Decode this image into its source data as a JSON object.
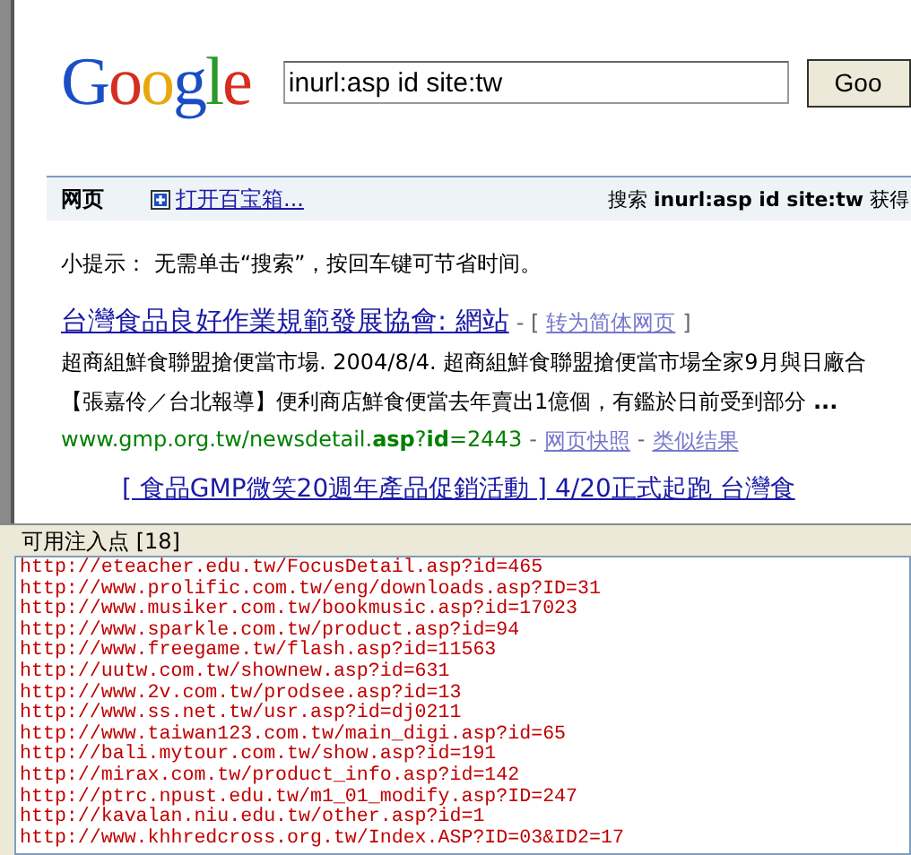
{
  "logo": "Google",
  "search": {
    "value": "inurl:asp id site:tw",
    "button": "Goo"
  },
  "bar": {
    "tab": "网页",
    "toolbox_link": "打开百宝箱...",
    "summary": "搜索 **inurl:asp id site:tw** 获得"
  },
  "tip": "小提示：  无需单击“搜索”，按回车键可节省时间。",
  "results": [
    {
      "title": "台灣食品良好作業規範發展協會: 網站",
      "sep_open": "- [",
      "translate": "转为简体网页",
      "sep_close": "]",
      "sep": "-",
      "snippet": [
        "超商組鮮食聯盟搶便當市場. 2004/8/4. 超商組鮮食聯盟搶便當市場全家9月與日廠合",
        "【張嘉伶／台北報導】便利商店鮮食便當去年賣出1億個，有鑑於日前受到部分 **...**"
      ],
      "url": "www.gmp.org.tw/newsdetail.**asp**?**id**=2443",
      "cache": "网页快照",
      "similar": "类似结果"
    },
    {
      "title": "[ 食品GMP微笑20週年產品促銷活動 ] 4/20正式起跑  台灣食"
    }
  ],
  "panel": {
    "title": "可用注入点 [18]",
    "urls": [
      "http://eteacher.edu.tw/FocusDetail.asp?id=465",
      "http://www.prolific.com.tw/eng/downloads.asp?ID=31",
      "http://www.musiker.com.tw/bookmusic.asp?id=17023",
      "http://www.sparkle.com.tw/product.asp?id=94",
      "http://www.freegame.tw/flash.asp?id=11563",
      "http://uutw.com.tw/shownew.asp?id=631",
      "http://www.2v.com.tw/prodsee.asp?id=13",
      "http://www.ss.net.tw/usr.asp?id=dj0211",
      "http://www.taiwan123.com.tw/main_digi.asp?id=65",
      "http://bali.mytour.com.tw/show.asp?id=191",
      "http://mirax.com.tw/product_info.asp?id=142",
      "http://ptrc.npust.edu.tw/m1_01_modify.asp?ID=247",
      "http://kavalan.niu.edu.tw/other.asp?id=1",
      "http://www.khhredcross.org.tw/Index.ASP?ID=03&ID2=17"
    ]
  }
}
